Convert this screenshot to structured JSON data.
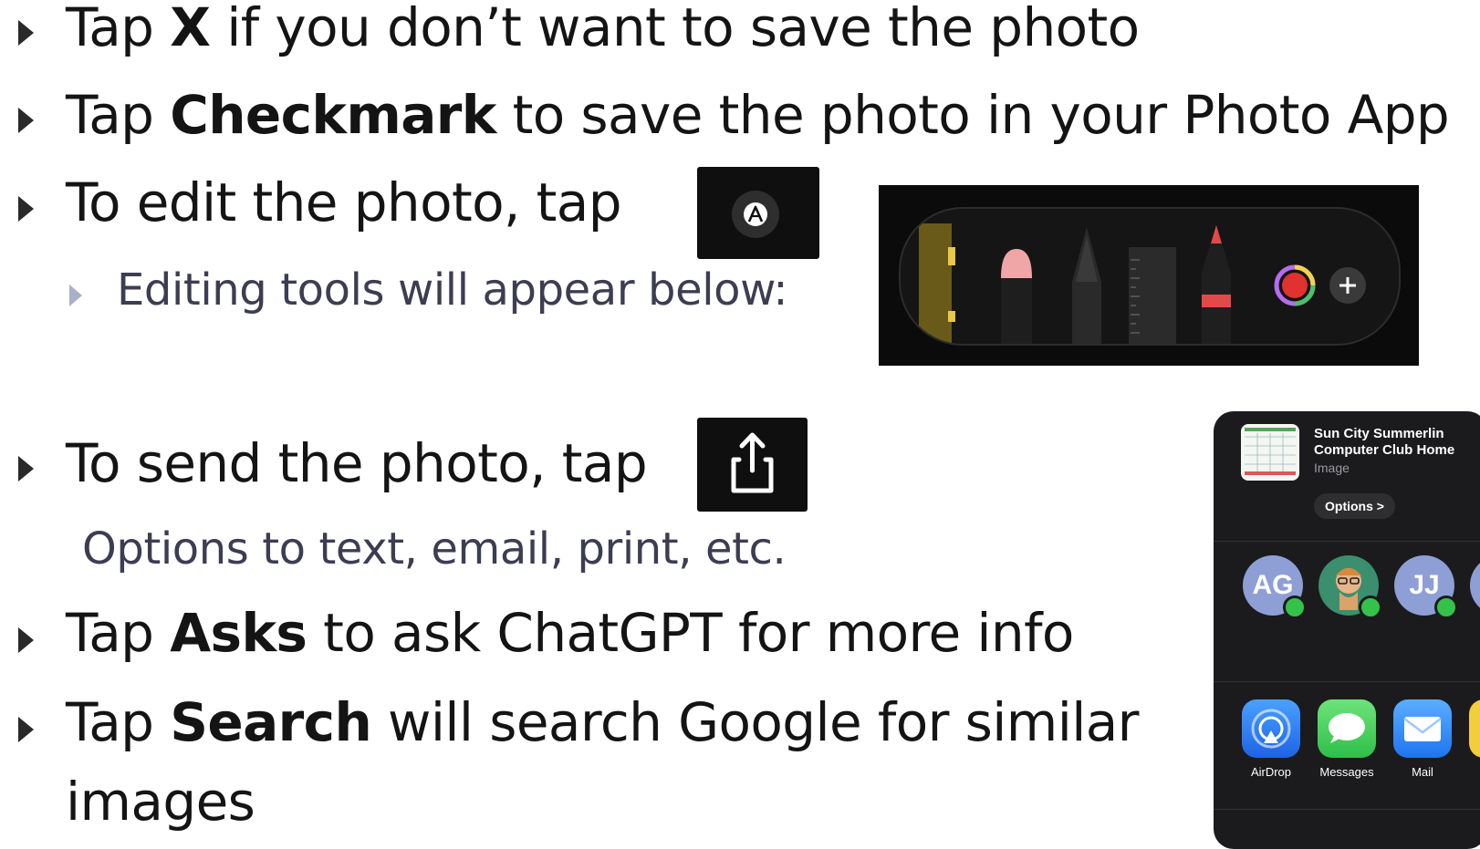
{
  "bullets": [
    {
      "pre": "Tap ",
      "bold": "X",
      "post": " if you don’t want to save the photo"
    },
    {
      "pre": "Tap ",
      "bold": "Checkmark",
      "post": " to save the photo in your Photo App"
    },
    {
      "text": "To edit the photo, tap"
    },
    {
      "text": "Editing tools will appear below:"
    },
    {
      "text": "To send the photo, tap"
    },
    {
      "text": "Options to text, email, print, etc."
    },
    {
      "pre": "Tap ",
      "bold": "Asks",
      "post": " to ask ChatGPT for more info"
    },
    {
      "pre": "Tap ",
      "bold": "Search",
      "post": " will search Google for similar"
    },
    {
      "text": "images"
    }
  ],
  "share_sheet": {
    "title_line1": "Sun City Summerlin",
    "title_line2": "Computer Club Home",
    "subtitle": "Image",
    "options_label": "Options >",
    "contacts": [
      "AG",
      "JJ"
    ],
    "apps": [
      "AirDrop",
      "Messages",
      "Mail"
    ]
  },
  "colors": {
    "text": "#141414",
    "sub_text": "#3d3d52",
    "airdrop": "#2f7cf6",
    "messages": "#34c759",
    "mail": "#2f86f7",
    "contact_bubble": "#8e9fd6"
  },
  "icons": {
    "markup": "pen-tip-in-circle",
    "share": "share-box-arrow-up"
  }
}
